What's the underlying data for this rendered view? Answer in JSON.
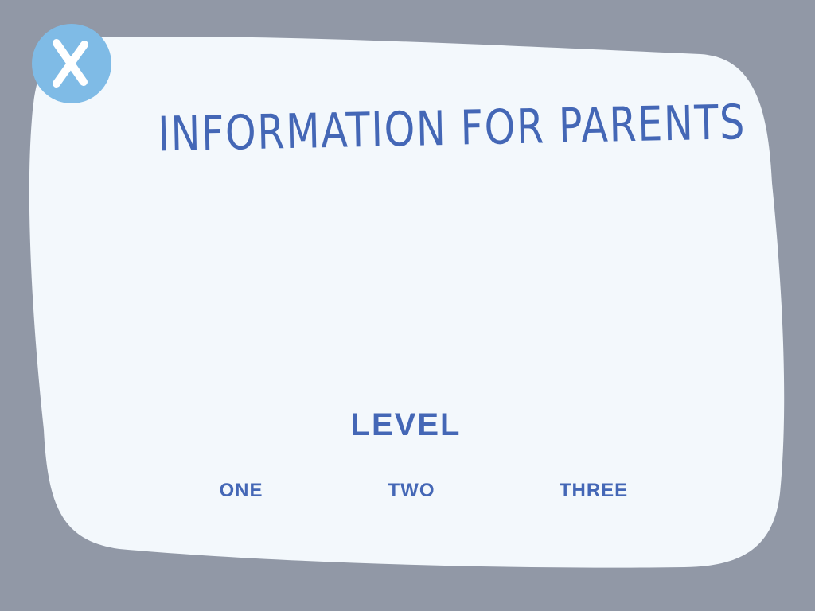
{
  "screen": {
    "title": "INFORMATION FOR PARENTS"
  },
  "close_button": {
    "icon": "close-icon",
    "glyph": "X"
  },
  "level_selector": {
    "label": "LEVEL",
    "options": [
      {
        "label": "ONE"
      },
      {
        "label": "TWO"
      },
      {
        "label": "THREE"
      }
    ]
  },
  "colors": {
    "background": "#9198a6",
    "panel": "#f3f8fc",
    "accent_text": "#4467b6",
    "close_button": "#7fbbe6"
  }
}
